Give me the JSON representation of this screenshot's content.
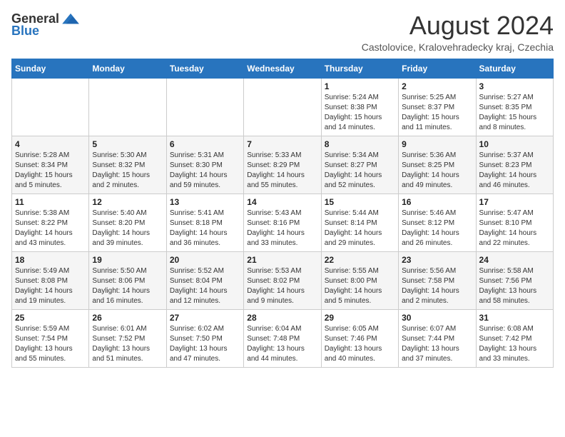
{
  "logo": {
    "general": "General",
    "blue": "Blue"
  },
  "header": {
    "month": "August 2024",
    "location": "Castolovice, Kralovehradecky kraj, Czechia"
  },
  "weekdays": [
    "Sunday",
    "Monday",
    "Tuesday",
    "Wednesday",
    "Thursday",
    "Friday",
    "Saturday"
  ],
  "weeks": [
    [
      {
        "day": "",
        "sunrise": "",
        "sunset": "",
        "daylight": ""
      },
      {
        "day": "",
        "sunrise": "",
        "sunset": "",
        "daylight": ""
      },
      {
        "day": "",
        "sunrise": "",
        "sunset": "",
        "daylight": ""
      },
      {
        "day": "",
        "sunrise": "",
        "sunset": "",
        "daylight": ""
      },
      {
        "day": "1",
        "sunrise": "5:24 AM",
        "sunset": "8:38 PM",
        "daylight": "15 hours and 14 minutes."
      },
      {
        "day": "2",
        "sunrise": "5:25 AM",
        "sunset": "8:37 PM",
        "daylight": "15 hours and 11 minutes."
      },
      {
        "day": "3",
        "sunrise": "5:27 AM",
        "sunset": "8:35 PM",
        "daylight": "15 hours and 8 minutes."
      }
    ],
    [
      {
        "day": "4",
        "sunrise": "5:28 AM",
        "sunset": "8:34 PM",
        "daylight": "15 hours and 5 minutes."
      },
      {
        "day": "5",
        "sunrise": "5:30 AM",
        "sunset": "8:32 PM",
        "daylight": "15 hours and 2 minutes."
      },
      {
        "day": "6",
        "sunrise": "5:31 AM",
        "sunset": "8:30 PM",
        "daylight": "14 hours and 59 minutes."
      },
      {
        "day": "7",
        "sunrise": "5:33 AM",
        "sunset": "8:29 PM",
        "daylight": "14 hours and 55 minutes."
      },
      {
        "day": "8",
        "sunrise": "5:34 AM",
        "sunset": "8:27 PM",
        "daylight": "14 hours and 52 minutes."
      },
      {
        "day": "9",
        "sunrise": "5:36 AM",
        "sunset": "8:25 PM",
        "daylight": "14 hours and 49 minutes."
      },
      {
        "day": "10",
        "sunrise": "5:37 AM",
        "sunset": "8:23 PM",
        "daylight": "14 hours and 46 minutes."
      }
    ],
    [
      {
        "day": "11",
        "sunrise": "5:38 AM",
        "sunset": "8:22 PM",
        "daylight": "14 hours and 43 minutes."
      },
      {
        "day": "12",
        "sunrise": "5:40 AM",
        "sunset": "8:20 PM",
        "daylight": "14 hours and 39 minutes."
      },
      {
        "day": "13",
        "sunrise": "5:41 AM",
        "sunset": "8:18 PM",
        "daylight": "14 hours and 36 minutes."
      },
      {
        "day": "14",
        "sunrise": "5:43 AM",
        "sunset": "8:16 PM",
        "daylight": "14 hours and 33 minutes."
      },
      {
        "day": "15",
        "sunrise": "5:44 AM",
        "sunset": "8:14 PM",
        "daylight": "14 hours and 29 minutes."
      },
      {
        "day": "16",
        "sunrise": "5:46 AM",
        "sunset": "8:12 PM",
        "daylight": "14 hours and 26 minutes."
      },
      {
        "day": "17",
        "sunrise": "5:47 AM",
        "sunset": "8:10 PM",
        "daylight": "14 hours and 22 minutes."
      }
    ],
    [
      {
        "day": "18",
        "sunrise": "5:49 AM",
        "sunset": "8:08 PM",
        "daylight": "14 hours and 19 minutes."
      },
      {
        "day": "19",
        "sunrise": "5:50 AM",
        "sunset": "8:06 PM",
        "daylight": "14 hours and 16 minutes."
      },
      {
        "day": "20",
        "sunrise": "5:52 AM",
        "sunset": "8:04 PM",
        "daylight": "14 hours and 12 minutes."
      },
      {
        "day": "21",
        "sunrise": "5:53 AM",
        "sunset": "8:02 PM",
        "daylight": "14 hours and 9 minutes."
      },
      {
        "day": "22",
        "sunrise": "5:55 AM",
        "sunset": "8:00 PM",
        "daylight": "14 hours and 5 minutes."
      },
      {
        "day": "23",
        "sunrise": "5:56 AM",
        "sunset": "7:58 PM",
        "daylight": "14 hours and 2 minutes."
      },
      {
        "day": "24",
        "sunrise": "5:58 AM",
        "sunset": "7:56 PM",
        "daylight": "13 hours and 58 minutes."
      }
    ],
    [
      {
        "day": "25",
        "sunrise": "5:59 AM",
        "sunset": "7:54 PM",
        "daylight": "13 hours and 55 minutes."
      },
      {
        "day": "26",
        "sunrise": "6:01 AM",
        "sunset": "7:52 PM",
        "daylight": "13 hours and 51 minutes."
      },
      {
        "day": "27",
        "sunrise": "6:02 AM",
        "sunset": "7:50 PM",
        "daylight": "13 hours and 47 minutes."
      },
      {
        "day": "28",
        "sunrise": "6:04 AM",
        "sunset": "7:48 PM",
        "daylight": "13 hours and 44 minutes."
      },
      {
        "day": "29",
        "sunrise": "6:05 AM",
        "sunset": "7:46 PM",
        "daylight": "13 hours and 40 minutes."
      },
      {
        "day": "30",
        "sunrise": "6:07 AM",
        "sunset": "7:44 PM",
        "daylight": "13 hours and 37 minutes."
      },
      {
        "day": "31",
        "sunrise": "6:08 AM",
        "sunset": "7:42 PM",
        "daylight": "13 hours and 33 minutes."
      }
    ]
  ]
}
